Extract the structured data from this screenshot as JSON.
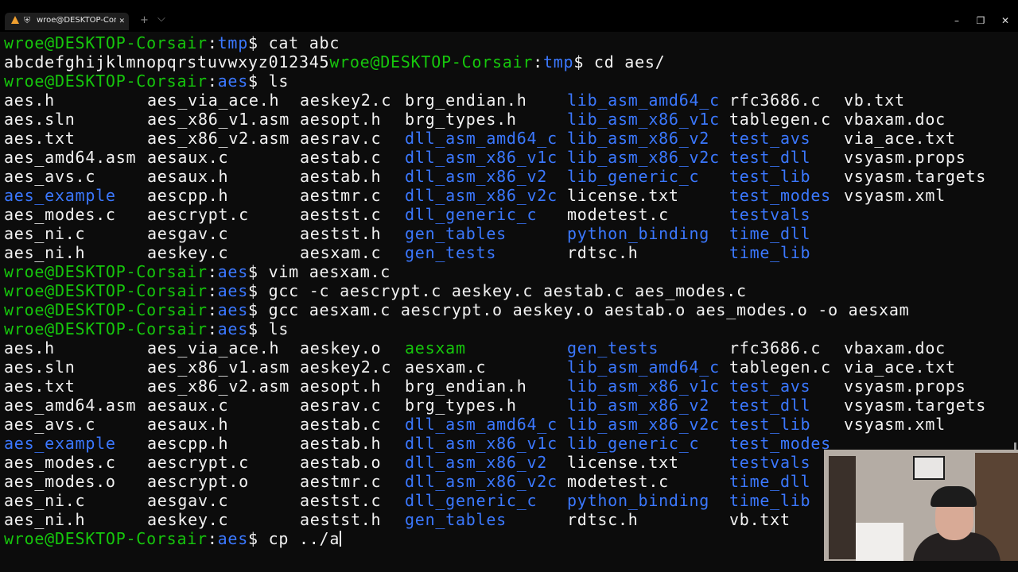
{
  "window": {
    "tab_title": "wroe@DESKTOP-Corsair: ~/",
    "tab_shield": "⛨",
    "tab_close": "✕",
    "new_tab": "+",
    "dropdown": "⌵",
    "minimize": "–",
    "maximize": "❐",
    "close": "✕"
  },
  "colors": {
    "background": "#0c0c0c",
    "prompt_user": "#16c60c",
    "path": "#3b78ff",
    "directory": "#3b78ff",
    "executable": "#16c60c",
    "text": "#f2f2f2"
  },
  "terminal": {
    "prompt_user": "wroe@DESKTOP-Corsair",
    "prompt_dollar": "$ ",
    "line1": {
      "path": "tmp",
      "cmd": "cat abc"
    },
    "line2": {
      "output": "abcdefghijklmnopqrstuvwxyz012345",
      "user": "wroe@DESKTOP-Corsair",
      "path": "tmp",
      "cmd": "cd aes/"
    },
    "line3": {
      "path": "aes",
      "cmd": "ls"
    },
    "ls1": {
      "col1": [
        {
          "t": "aes.h",
          "k": "file"
        },
        {
          "t": "aes.sln",
          "k": "file"
        },
        {
          "t": "aes.txt",
          "k": "file"
        },
        {
          "t": "aes_amd64.asm",
          "k": "file"
        },
        {
          "t": "aes_avs.c",
          "k": "file"
        },
        {
          "t": "aes_example",
          "k": "dir"
        },
        {
          "t": "aes_modes.c",
          "k": "file"
        },
        {
          "t": "aes_ni.c",
          "k": "file"
        },
        {
          "t": "aes_ni.h",
          "k": "file"
        }
      ],
      "col2": [
        {
          "t": "aes_via_ace.h",
          "k": "file"
        },
        {
          "t": "aes_x86_v1.asm",
          "k": "file"
        },
        {
          "t": "aes_x86_v2.asm",
          "k": "file"
        },
        {
          "t": "aesaux.c",
          "k": "file"
        },
        {
          "t": "aesaux.h",
          "k": "file"
        },
        {
          "t": "aescpp.h",
          "k": "file"
        },
        {
          "t": "aescrypt.c",
          "k": "file"
        },
        {
          "t": "aesgav.c",
          "k": "file"
        },
        {
          "t": "aeskey.c",
          "k": "file"
        }
      ],
      "col3": [
        {
          "t": "aeskey2.c",
          "k": "file"
        },
        {
          "t": "aesopt.h",
          "k": "file"
        },
        {
          "t": "aesrav.c",
          "k": "file"
        },
        {
          "t": "aestab.c",
          "k": "file"
        },
        {
          "t": "aestab.h",
          "k": "file"
        },
        {
          "t": "aestmr.c",
          "k": "file"
        },
        {
          "t": "aestst.c",
          "k": "file"
        },
        {
          "t": "aestst.h",
          "k": "file"
        },
        {
          "t": "aesxam.c",
          "k": "file"
        }
      ],
      "col4": [
        {
          "t": "brg_endian.h",
          "k": "file"
        },
        {
          "t": "brg_types.h",
          "k": "file"
        },
        {
          "t": "dll_asm_amd64_c",
          "k": "dir"
        },
        {
          "t": "dll_asm_x86_v1c",
          "k": "dir"
        },
        {
          "t": "dll_asm_x86_v2",
          "k": "dir"
        },
        {
          "t": "dll_asm_x86_v2c",
          "k": "dir"
        },
        {
          "t": "dll_generic_c",
          "k": "dir"
        },
        {
          "t": "gen_tables",
          "k": "dir"
        },
        {
          "t": "gen_tests",
          "k": "dir"
        }
      ],
      "col5": [
        {
          "t": "lib_asm_amd64_c",
          "k": "dir"
        },
        {
          "t": "lib_asm_x86_v1c",
          "k": "dir"
        },
        {
          "t": "lib_asm_x86_v2",
          "k": "dir"
        },
        {
          "t": "lib_asm_x86_v2c",
          "k": "dir"
        },
        {
          "t": "lib_generic_c",
          "k": "dir"
        },
        {
          "t": "license.txt",
          "k": "file"
        },
        {
          "t": "modetest.c",
          "k": "file"
        },
        {
          "t": "python_binding",
          "k": "dir"
        },
        {
          "t": "rdtsc.h",
          "k": "file"
        }
      ],
      "col6": [
        {
          "t": "rfc3686.c",
          "k": "file"
        },
        {
          "t": "tablegen.c",
          "k": "file"
        },
        {
          "t": "test_avs",
          "k": "dir"
        },
        {
          "t": "test_dll",
          "k": "dir"
        },
        {
          "t": "test_lib",
          "k": "dir"
        },
        {
          "t": "test_modes",
          "k": "dir"
        },
        {
          "t": "testvals",
          "k": "dir"
        },
        {
          "t": "time_dll",
          "k": "dir"
        },
        {
          "t": "time_lib",
          "k": "dir"
        }
      ],
      "col7": [
        {
          "t": "vb.txt",
          "k": "file"
        },
        {
          "t": "vbaxam.doc",
          "k": "file"
        },
        {
          "t": "via_ace.txt",
          "k": "file"
        },
        {
          "t": "vsyasm.props",
          "k": "file"
        },
        {
          "t": "vsyasm.targets",
          "k": "file"
        },
        {
          "t": "vsyasm.xml",
          "k": "file"
        }
      ]
    },
    "cmd_vim": {
      "path": "aes",
      "cmd": "vim aesxam.c"
    },
    "cmd_gcc1": {
      "path": "aes",
      "cmd": "gcc -c aescrypt.c aeskey.c aestab.c aes_modes.c"
    },
    "cmd_gcc2": {
      "path": "aes",
      "cmd": "gcc aesxam.c aescrypt.o aeskey.o aestab.o aes_modes.o -o aesxam"
    },
    "cmd_ls2": {
      "path": "aes",
      "cmd": "ls"
    },
    "ls2": {
      "col1": [
        {
          "t": "aes.h",
          "k": "file"
        },
        {
          "t": "aes.sln",
          "k": "file"
        },
        {
          "t": "aes.txt",
          "k": "file"
        },
        {
          "t": "aes_amd64.asm",
          "k": "file"
        },
        {
          "t": "aes_avs.c",
          "k": "file"
        },
        {
          "t": "aes_example",
          "k": "dir"
        },
        {
          "t": "aes_modes.c",
          "k": "file"
        },
        {
          "t": "aes_modes.o",
          "k": "file"
        },
        {
          "t": "aes_ni.c",
          "k": "file"
        },
        {
          "t": "aes_ni.h",
          "k": "file"
        }
      ],
      "col2": [
        {
          "t": "aes_via_ace.h",
          "k": "file"
        },
        {
          "t": "aes_x86_v1.asm",
          "k": "file"
        },
        {
          "t": "aes_x86_v2.asm",
          "k": "file"
        },
        {
          "t": "aesaux.c",
          "k": "file"
        },
        {
          "t": "aesaux.h",
          "k": "file"
        },
        {
          "t": "aescpp.h",
          "k": "file"
        },
        {
          "t": "aescrypt.c",
          "k": "file"
        },
        {
          "t": "aescrypt.o",
          "k": "file"
        },
        {
          "t": "aesgav.c",
          "k": "file"
        },
        {
          "t": "aeskey.c",
          "k": "file"
        }
      ],
      "col3": [
        {
          "t": "aeskey.o",
          "k": "file"
        },
        {
          "t": "aeskey2.c",
          "k": "file"
        },
        {
          "t": "aesopt.h",
          "k": "file"
        },
        {
          "t": "aesrav.c",
          "k": "file"
        },
        {
          "t": "aestab.c",
          "k": "file"
        },
        {
          "t": "aestab.h",
          "k": "file"
        },
        {
          "t": "aestab.o",
          "k": "file"
        },
        {
          "t": "aestmr.c",
          "k": "file"
        },
        {
          "t": "aestst.c",
          "k": "file"
        },
        {
          "t": "aestst.h",
          "k": "file"
        }
      ],
      "col4": [
        {
          "t": "aesxam",
          "k": "exec"
        },
        {
          "t": "aesxam.c",
          "k": "file"
        },
        {
          "t": "brg_endian.h",
          "k": "file"
        },
        {
          "t": "brg_types.h",
          "k": "file"
        },
        {
          "t": "dll_asm_amd64_c",
          "k": "dir"
        },
        {
          "t": "dll_asm_x86_v1c",
          "k": "dir"
        },
        {
          "t": "dll_asm_x86_v2",
          "k": "dir"
        },
        {
          "t": "dll_asm_x86_v2c",
          "k": "dir"
        },
        {
          "t": "dll_generic_c",
          "k": "dir"
        },
        {
          "t": "gen_tables",
          "k": "dir"
        }
      ],
      "col5": [
        {
          "t": "gen_tests",
          "k": "dir"
        },
        {
          "t": "lib_asm_amd64_c",
          "k": "dir"
        },
        {
          "t": "lib_asm_x86_v1c",
          "k": "dir"
        },
        {
          "t": "lib_asm_x86_v2",
          "k": "dir"
        },
        {
          "t": "lib_asm_x86_v2c",
          "k": "dir"
        },
        {
          "t": "lib_generic_c",
          "k": "dir"
        },
        {
          "t": "license.txt",
          "k": "file"
        },
        {
          "t": "modetest.c",
          "k": "file"
        },
        {
          "t": "python_binding",
          "k": "dir"
        },
        {
          "t": "rdtsc.h",
          "k": "file"
        }
      ],
      "col6": [
        {
          "t": "rfc3686.c",
          "k": "file"
        },
        {
          "t": "tablegen.c",
          "k": "file"
        },
        {
          "t": "test_avs",
          "k": "dir"
        },
        {
          "t": "test_dll",
          "k": "dir"
        },
        {
          "t": "test_lib",
          "k": "dir"
        },
        {
          "t": "test_modes",
          "k": "dir"
        },
        {
          "t": "testvals",
          "k": "dir"
        },
        {
          "t": "time_dll",
          "k": "dir"
        },
        {
          "t": "time_lib",
          "k": "dir"
        },
        {
          "t": "vb.txt",
          "k": "file"
        }
      ],
      "col7": [
        {
          "t": "vbaxam.doc",
          "k": "file"
        },
        {
          "t": "via_ace.txt",
          "k": "file"
        },
        {
          "t": "vsyasm.props",
          "k": "file"
        },
        {
          "t": "vsyasm.targets",
          "k": "file"
        },
        {
          "t": "vsyasm.xml",
          "k": "file"
        }
      ]
    },
    "current": {
      "path": "aes",
      "cmd": "cp ../a"
    }
  }
}
